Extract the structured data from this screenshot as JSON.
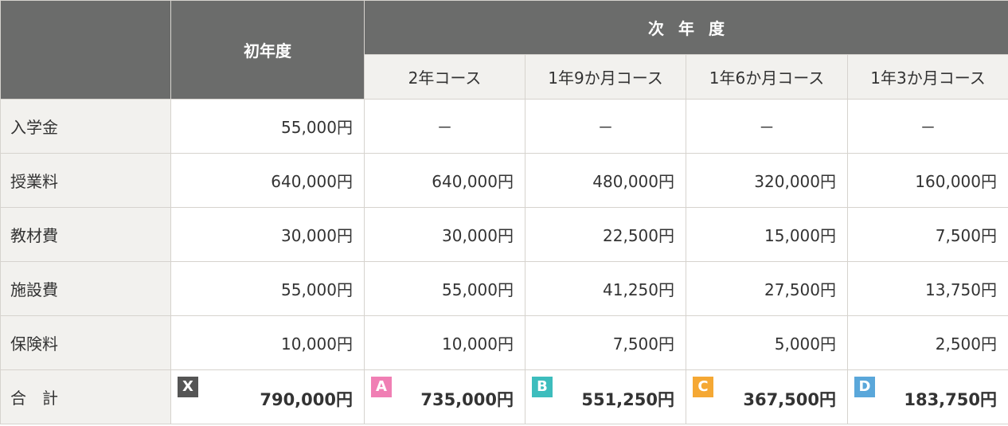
{
  "header": {
    "first_year": "初年度",
    "next_year": "次年度",
    "courses": [
      "2年コース",
      "1年9か月コース",
      "1年6か月コース",
      "1年3か月コース"
    ]
  },
  "rows": [
    {
      "label": "入学金",
      "first": "55,000円",
      "values": [
        "－",
        "－",
        "－",
        "－"
      ]
    },
    {
      "label": "授業料",
      "first": "640,000円",
      "values": [
        "640,000円",
        "480,000円",
        "320,000円",
        "160,000円"
      ]
    },
    {
      "label": "教材費",
      "first": "30,000円",
      "values": [
        "30,000円",
        "22,500円",
        "15,000円",
        "7,500円"
      ]
    },
    {
      "label": "施設費",
      "first": "55,000円",
      "values": [
        "55,000円",
        "41,250円",
        "27,500円",
        "13,750円"
      ]
    },
    {
      "label": "保険料",
      "first": "10,000円",
      "values": [
        "10,000円",
        "7,500円",
        "5,000円",
        "2,500円"
      ]
    }
  ],
  "total": {
    "label": "合計",
    "cells": [
      {
        "badge": "X",
        "color": "#555555",
        "value": "790,000円"
      },
      {
        "badge": "A",
        "color": "#f07fb4",
        "value": "735,000円"
      },
      {
        "badge": "B",
        "color": "#3dbdbd",
        "value": "551,250円"
      },
      {
        "badge": "C",
        "color": "#f5a834",
        "value": "367,500円"
      },
      {
        "badge": "D",
        "color": "#5aa7da",
        "value": "183,750円"
      }
    ]
  }
}
